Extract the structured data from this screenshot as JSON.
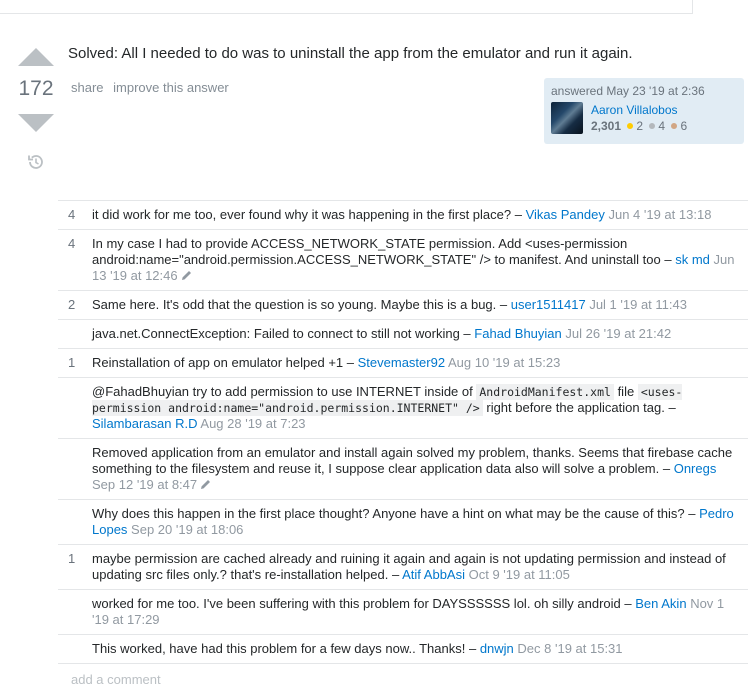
{
  "answer": {
    "votes": "172",
    "text": "Solved: All I needed to do was to uninstall the app from the emulator and run it again.",
    "menu": [
      "share",
      "improve this answer"
    ]
  },
  "user_card": {
    "action": "answered May 23 '19 at 2:36",
    "name": "Aaron Villalobos",
    "reputation": "2,301",
    "gold": "2",
    "silver": "4",
    "bronze": "6"
  },
  "comments": [
    {
      "score": "4",
      "text": "it did work for me too, ever found why it was happening in the first place? –",
      "user": "Vikas Pandey",
      "date": "Jun 4 '19 at 13:18"
    },
    {
      "score": "4",
      "text": "In my case I had to provide ACCESS_NETWORK_STATE permission. Add <uses-permission android:name=\"android.permission.ACCESS_NETWORK_STATE\" /> to manifest. And uninstall too –",
      "user": "sk md",
      "date": "Jun 13 '19 at 12:46"
    },
    {
      "score": "2",
      "text": "Same here. It's odd that the question is so young. Maybe this is a bug. –",
      "user": "user1511417",
      "date": "Jul 1 '19 at 11:43"
    },
    {
      "score": "",
      "text": "java.net.ConnectException: Failed to connect to still not working –",
      "user": "Fahad Bhuyian",
      "date": "Jul 26 '19 at 21:42"
    },
    {
      "score": "1",
      "text": "Reinstallation of app on emulator helped +1 –",
      "user": "Stevemaster92",
      "date": "Aug 10 '19 at 15:23"
    },
    {
      "score": "",
      "pre": "@FahadBhuyian try to add permission to use INTERNET inside of",
      "code1": "AndroidManifest.xml",
      "mid": "file",
      "code2": "<uses-permission android:name=\"android.permission.INTERNET\" />",
      "post": "right before the application tag. –",
      "user": "Silambarasan R.D",
      "date": "Aug 28 '19 at 7:23"
    },
    {
      "score": "",
      "text": "Removed application from an emulator and install again solved my problem, thanks. Seems that firebase cache something to the filesystem and reuse it, I suppose clear application data also will solve a problem. –",
      "user": "Onregs",
      "date": "Sep 12 '19 at 8:47"
    },
    {
      "score": "",
      "text": "Why does this happen in the first place thought? Anyone have a hint on what may be the cause of this? –",
      "user": "Pedro Lopes",
      "date": "Sep 20 '19 at 18:06"
    },
    {
      "score": "1",
      "text": "maybe permission are cached already and ruining it again and again is not updating permission and instead of updating src files only.? that's re-installation helped. –",
      "user": "Atif AbbAsi",
      "date": "Oct 9 '19 at 11:05"
    },
    {
      "score": "",
      "text": "worked for me too. I've been suffering with this problem for DAYSSSSSS lol. oh silly android –",
      "user": "Ben Akin",
      "date": "Nov 1 '19 at 17:29"
    },
    {
      "score": "",
      "text": "This worked, have had this problem for a few days now.. Thanks! –",
      "user": "dnwjn",
      "date": "Dec 8 '19 at 15:31"
    }
  ],
  "add_comment": "add a comment",
  "colors": {
    "link": "#0077cc",
    "gold": "#ffcc01",
    "silver": "#b4b8bc",
    "bronze": "#d1a684"
  }
}
